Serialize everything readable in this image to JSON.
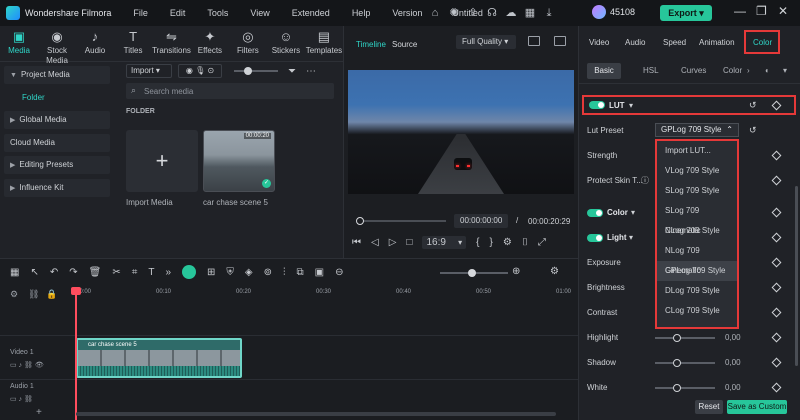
{
  "titlebar": {
    "app_name": "Wondershare Filmora",
    "menu": [
      "File",
      "Edit",
      "Tools",
      "View",
      "Extended",
      "Help",
      "Version"
    ],
    "doc_title": "Untitled",
    "credits": "45108",
    "export_label": "Export",
    "icons": [
      "gift-icon",
      "bulb-icon",
      "upload-icon",
      "headset-icon",
      "cloud-icon",
      "grid-icon",
      "download-icon"
    ]
  },
  "media": {
    "tabs": [
      {
        "label": "Media",
        "icon": "media-icon",
        "glyph": "▣"
      },
      {
        "label": "Stock Media",
        "icon": "stock-media-icon",
        "glyph": "◉"
      },
      {
        "label": "Audio",
        "icon": "audio-icon",
        "glyph": "♪"
      },
      {
        "label": "Titles",
        "icon": "titles-icon",
        "glyph": "T"
      },
      {
        "label": "Transitions",
        "icon": "transitions-icon",
        "glyph": "⇋"
      },
      {
        "label": "Effects",
        "icon": "effects-icon",
        "glyph": "✦"
      },
      {
        "label": "Filters",
        "icon": "filters-icon",
        "glyph": "◎"
      },
      {
        "label": "Stickers",
        "icon": "stickers-icon",
        "glyph": "☺"
      },
      {
        "label": "Templates",
        "icon": "templates-icon",
        "glyph": "▤"
      }
    ],
    "nav": {
      "project_media": "Project Media",
      "folder": "Folder",
      "global_media": "Global Media",
      "cloud_media": "Cloud Media",
      "editing_presets": "Editing Presets",
      "influence_kit": "Influence Kit"
    },
    "import_label": "Import",
    "search_placeholder": "Search media",
    "folder_heading": "FOLDER",
    "import_card_label": "Import Media",
    "clip": {
      "name": "car chase scene 5",
      "duration": "00:00:20"
    }
  },
  "preview": {
    "tab_timeline": "Timeline",
    "tab_source": "Source",
    "quality": "Full Quality",
    "current_time": "00:00:00:00",
    "separator": "/",
    "total_time": "00:00:20:29",
    "ratio": "16:9"
  },
  "timeline": {
    "ticks": [
      "00:00",
      "00:10",
      "00:20",
      "00:30",
      "00:40",
      "00:50",
      "01:00"
    ],
    "video_track": "Video 1",
    "audio_track": "Audio 1",
    "clip_name": "car chase scene 5"
  },
  "right": {
    "tabs": [
      "Video",
      "Audio",
      "Speed",
      "Animation",
      "Color"
    ],
    "active_tab": "Color",
    "subtabs": [
      "Basic",
      "HSL",
      "Curves",
      "Color"
    ],
    "lut_label": "LUT",
    "lut_preset_label": "Lut Preset",
    "lut_preset_value": "GPLog 709 Style",
    "strength_label": "Strength",
    "protect_skin_label": "Protect Skin T...",
    "color_label": "Color",
    "light_label": "Light",
    "exposure_label": "Exposure",
    "brightness_label": "Brightness",
    "contrast_label": "Contrast",
    "highlight_label": "Highlight",
    "shadow_label": "Shadow",
    "white_label": "White",
    "highlight_value": "0,00",
    "shadow_value": "0,00",
    "white_value": "0,00",
    "lut_options": [
      "Import LUT...",
      "VLog 709 Style",
      "SLog 709 Style",
      "SLog 709 Cinematic",
      "NLog 709 Style",
      "NLog 709 Cinematic",
      "GPLog 709 Style",
      "DLog 709 Style",
      "CLog 709 Style"
    ],
    "selected_option": "GPLog 709 Style",
    "reset_label": "Reset",
    "save_label": "Save as Custom"
  },
  "colors": {
    "accent": "#2fd6c8",
    "export_green": "#27c69a",
    "highlight_red": "#e53939",
    "playhead": "#ff4d5e"
  }
}
